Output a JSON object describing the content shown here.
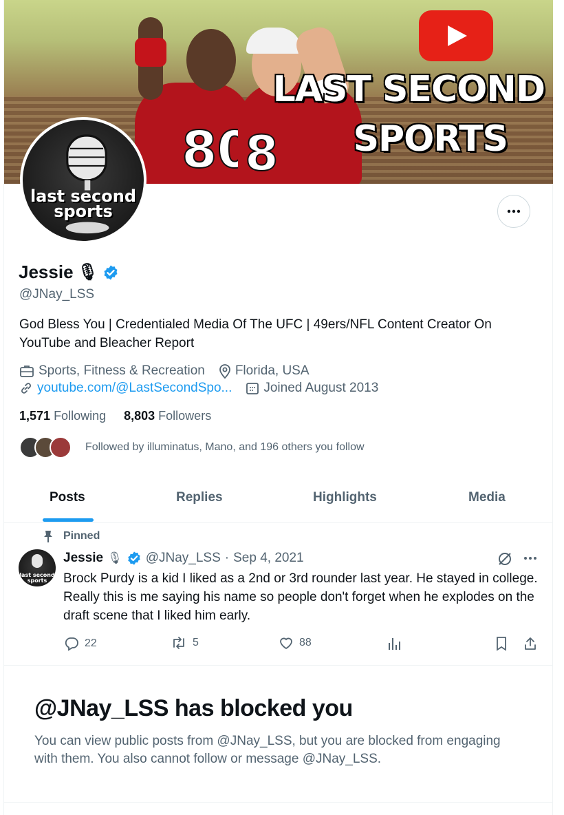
{
  "banner": {
    "title_line1": "LAST SECOND",
    "title_line2": "SPORTS",
    "jersey_left": "80",
    "jersey_right": "8"
  },
  "avatar": {
    "text_line1": "last second",
    "text_line2": "sports"
  },
  "profile": {
    "name": "Jessie",
    "name_emoji": "🎙",
    "handle": "@JNay_LSS",
    "bio": "God Bless You | Credentialed Media Of The UFC | 49ers/NFL Content Creator On YouTube and Bleacher Report",
    "category": "Sports, Fitness & Recreation",
    "location": "Florida, USA",
    "website": "youtube.com/@LastSecondSpo...",
    "joined": "Joined August 2013",
    "following_count": "1,571",
    "following_label": "Following",
    "followers_count": "8,803",
    "followers_label": "Followers",
    "followed_by": "Followed by illuminatus, Mano, and 196 others you follow"
  },
  "tabs": [
    {
      "label": "Posts",
      "active": true
    },
    {
      "label": "Replies",
      "active": false
    },
    {
      "label": "Highlights",
      "active": false
    },
    {
      "label": "Media",
      "active": false
    }
  ],
  "pinned_post": {
    "pinned_label": "Pinned",
    "author": "Jessie",
    "handle": "@JNay_LSS",
    "separator": "·",
    "date": "Sep 4, 2021",
    "text": "Brock Purdy is a kid I liked as a 2nd or 3rd rounder last year. He stayed in college. Really this is me saying his name so people don't forget when he explodes on the draft scene that I liked him early.",
    "replies": "22",
    "reposts": "5",
    "likes": "88"
  },
  "blocked": {
    "title": "@JNay_LSS has blocked you",
    "body": "You can view public posts from @JNay_LSS, but you are blocked from engaging with them. You also cannot follow or message @JNay_LSS."
  },
  "colors": {
    "accent": "#1d9bf0",
    "secondary_text": "#536471",
    "primary_text": "#0f1419",
    "youtube_red": "#e62117"
  }
}
